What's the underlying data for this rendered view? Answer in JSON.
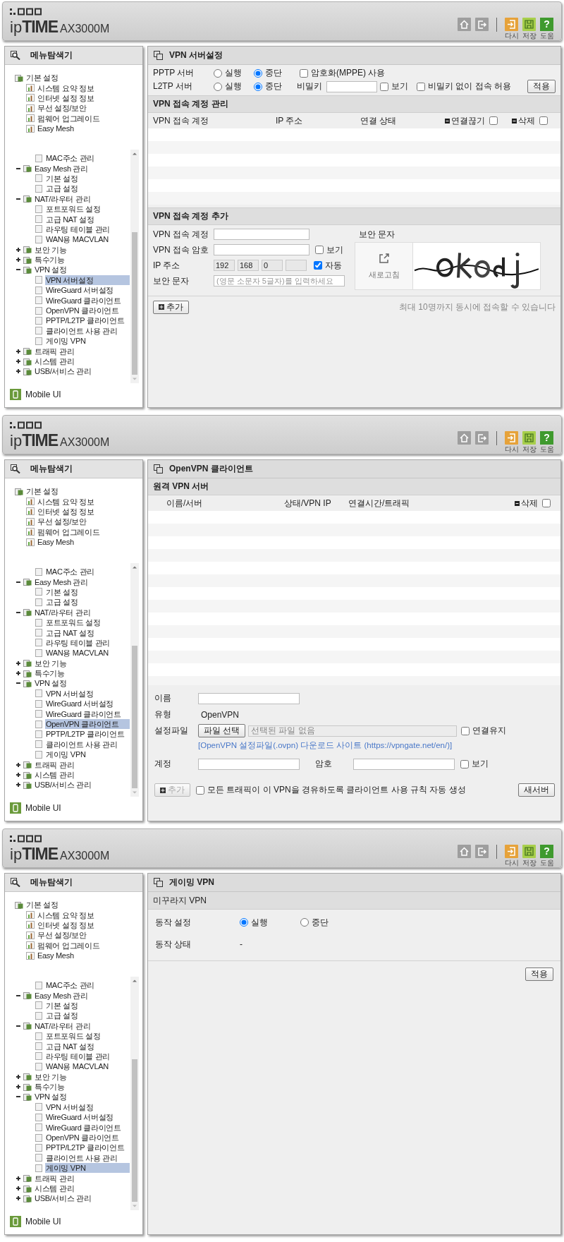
{
  "screens": [
    {
      "header": {
        "logo": {
          "prefix": "ip",
          "name": "TIME",
          "model": "AX3000M"
        },
        "actions": [
          {
            "kind": "home"
          },
          {
            "kind": "logout"
          },
          {
            "kind": "refresh",
            "label": "다시"
          },
          {
            "kind": "save",
            "label": "저장"
          },
          {
            "kind": "help",
            "label": "도움",
            "glyph": "?"
          }
        ]
      },
      "sidebar": {
        "title": "메뉴탐색기",
        "top_tree": [
          {
            "label": "기본 설정",
            "selected": false,
            "children": [
              {
                "label": "시스템 요약 정보",
                "selected": false
              },
              {
                "label": "인터넷 설정 정보",
                "selected": false
              },
              {
                "label": "무선 설정/보안",
                "selected": false
              },
              {
                "label": "펌웨어 업그레이드",
                "selected": false
              },
              {
                "label": "Easy Mesh",
                "selected": false
              }
            ]
          }
        ],
        "scroll_tree": [
          {
            "children": [
              {
                "label": "MAC주소 관리",
                "selected": false
              }
            ]
          },
          {
            "label": "Easy Mesh 관리",
            "expanded": true,
            "selected": false,
            "children": [
              {
                "label": "기본 설정",
                "selected": false
              },
              {
                "label": "고급 설정",
                "selected": false
              }
            ]
          },
          {
            "label": "NAT/라우터 관리",
            "expanded": true,
            "selected": false,
            "children": [
              {
                "label": "포트포워드 설정",
                "selected": false
              },
              {
                "label": "고급 NAT 설정",
                "selected": false
              },
              {
                "label": "라우팅 테이블 관리",
                "selected": false
              },
              {
                "label": "WAN용 MACVLAN",
                "selected": false
              }
            ]
          },
          {
            "label": "보안 기능",
            "expanded": false,
            "selected": false
          },
          {
            "label": "특수기능",
            "expanded": false,
            "selected": false
          },
          {
            "label": "VPN 설정",
            "expanded": true,
            "selected": false,
            "children": [
              {
                "label": "VPN 서버설정",
                "selected": true
              },
              {
                "label": "WireGuard 서버설정",
                "selected": false
              },
              {
                "label": "WireGuard 클라이언트",
                "selected": false
              },
              {
                "label": "OpenVPN 클라이언트",
                "selected": false
              },
              {
                "label": "PPTP/L2TP 클라이언트",
                "selected": false
              },
              {
                "label": "클라이언트 사용 관리",
                "selected": false
              },
              {
                "label": "게이밍 VPN",
                "selected": false
              }
            ]
          },
          {
            "label": "트래픽 관리",
            "expanded": false,
            "selected": false
          },
          {
            "label": "시스템 관리",
            "expanded": false,
            "selected": false
          },
          {
            "label": "USB/서비스 관리",
            "expanded": false,
            "selected": false
          }
        ],
        "mobile_link": "Mobile UI"
      },
      "main": {
        "kind": "vpn_server",
        "title": "VPN 서버설정",
        "servers": [
          {
            "label": "PPTP 서버",
            "options": [
              {
                "label": "실행",
                "selected": false
              },
              {
                "label": "중단",
                "selected": true
              }
            ],
            "encryption": {
              "label": "암호화(MPPE) 사용",
              "checked": false
            }
          },
          {
            "label": "L2TP 서버",
            "options": [
              {
                "label": "실행",
                "selected": false
              },
              {
                "label": "중단",
                "selected": true
              }
            ],
            "secret_label": "비밀키",
            "show": {
              "label": "보기",
              "checked": false
            },
            "no_secret": {
              "label": "비밀키 없이 접속 허용",
              "checked": false
            }
          }
        ],
        "apply_button": "적용",
        "accounts": {
          "title": "VPN 접속 계정 관리",
          "columns": [
            {
              "label": "VPN 접속 계정"
            },
            {
              "label": "IP 주소"
            },
            {
              "label": "연결 상태"
            },
            {
              "label": "연결끊기",
              "checked": false
            },
            {
              "label": "삭제",
              "checked": false
            }
          ]
        },
        "add": {
          "title": "VPN 접속 계정 추가",
          "account_label": "VPN 접속 계정",
          "password_label": "VPN 접속 암호",
          "show": {
            "label": "보기",
            "checked": false
          },
          "ip_label": "IP 주소",
          "ip": [
            "192",
            "168",
            "0"
          ],
          "auto": {
            "label": "자동",
            "checked": true
          },
          "captcha_label": "보안 문자",
          "captcha_placeholder": "(영문 소문자 5글자)를 입력하세요",
          "captcha_title": "보안 문자",
          "refresh": "새로고침",
          "add_button": "추가",
          "note": "최대 10명까지 동시에 접속할 수 있습니다"
        }
      }
    },
    {
      "header": {
        "logo": {
          "prefix": "ip",
          "name": "TIME",
          "model": "AX3000M"
        },
        "actions": [
          {
            "kind": "home"
          },
          {
            "kind": "logout"
          },
          {
            "kind": "refresh",
            "label": "다시"
          },
          {
            "kind": "save",
            "label": "저장"
          },
          {
            "kind": "help",
            "label": "도움",
            "glyph": "?"
          }
        ]
      },
      "sidebar": {
        "title": "메뉴탐색기",
        "top_tree": [
          {
            "label": "기본 설정",
            "selected": false,
            "children": [
              {
                "label": "시스템 요약 정보",
                "selected": false
              },
              {
                "label": "인터넷 설정 정보",
                "selected": false
              },
              {
                "label": "무선 설정/보안",
                "selected": false
              },
              {
                "label": "펌웨어 업그레이드",
                "selected": false
              },
              {
                "label": "Easy Mesh",
                "selected": false
              }
            ]
          }
        ],
        "scroll_tree": [
          {
            "children": [
              {
                "label": "MAC주소 관리",
                "selected": false
              }
            ]
          },
          {
            "label": "Easy Mesh 관리",
            "expanded": true,
            "selected": false,
            "children": [
              {
                "label": "기본 설정",
                "selected": false
              },
              {
                "label": "고급 설정",
                "selected": false
              }
            ]
          },
          {
            "label": "NAT/라우터 관리",
            "expanded": true,
            "selected": false,
            "children": [
              {
                "label": "포트포워드 설정",
                "selected": false
              },
              {
                "label": "고급 NAT 설정",
                "selected": false
              },
              {
                "label": "라우팅 테이블 관리",
                "selected": false
              },
              {
                "label": "WAN용 MACVLAN",
                "selected": false
              }
            ]
          },
          {
            "label": "보안 기능",
            "expanded": false,
            "selected": false
          },
          {
            "label": "특수기능",
            "expanded": false,
            "selected": false
          },
          {
            "label": "VPN 설정",
            "expanded": true,
            "selected": false,
            "children": [
              {
                "label": "VPN 서버설정",
                "selected": false
              },
              {
                "label": "WireGuard 서버설정",
                "selected": false
              },
              {
                "label": "WireGuard 클라이언트",
                "selected": false
              },
              {
                "label": "OpenVPN 클라이언트",
                "selected": true
              },
              {
                "label": "PPTP/L2TP 클라이언트",
                "selected": false
              },
              {
                "label": "클라이언트 사용 관리",
                "selected": false
              },
              {
                "label": "게이밍 VPN",
                "selected": false
              }
            ]
          },
          {
            "label": "트래픽 관리",
            "expanded": false,
            "selected": false
          },
          {
            "label": "시스템 관리",
            "expanded": false,
            "selected": false
          },
          {
            "label": "USB/서비스 관리",
            "expanded": false,
            "selected": false
          }
        ],
        "mobile_link": "Mobile UI"
      },
      "main": {
        "kind": "openvpn",
        "title": "OpenVPN 클라이언트",
        "subtitle": "원격 VPN 서버",
        "columns": [
          {
            "label": "이름/서버"
          },
          {
            "label": "상태/VPN IP"
          },
          {
            "label": "연결시간/트래픽"
          },
          {
            "label": "삭제",
            "checked": false
          }
        ],
        "name_label": "이름",
        "type_label": "유형",
        "type_value": "OpenVPN",
        "file_label": "설정파일",
        "file_button": "파일 선택",
        "file_status": "선택된 파일 없음",
        "keep_alive": {
          "label": "연결유지",
          "checked": false
        },
        "download_link": "[OpenVPN 설정파일(.ovpn) 다운로드 사이트 (https://vpngate.net/en/)]",
        "account_label": "계정",
        "password_label": "암호",
        "show": {
          "label": "보기",
          "checked": false
        },
        "add_button": {
          "label": "추가",
          "disabled": true
        },
        "auto_rule": {
          "label": "모든 트래픽이 이 VPN을 경유하도록 클라이언트 사용 규칙 자동 생성",
          "checked": false
        },
        "new_server_button": "새서버"
      }
    },
    {
      "header": {
        "logo": {
          "prefix": "ip",
          "name": "TIME",
          "model": "AX3000M"
        },
        "actions": [
          {
            "kind": "home"
          },
          {
            "kind": "logout"
          },
          {
            "kind": "refresh",
            "label": "다시"
          },
          {
            "kind": "save",
            "label": "저장"
          },
          {
            "kind": "help",
            "label": "도움",
            "glyph": "?"
          }
        ]
      },
      "sidebar": {
        "title": "메뉴탐색기",
        "top_tree": [
          {
            "label": "기본 설정",
            "selected": false,
            "children": [
              {
                "label": "시스템 요약 정보",
                "selected": false
              },
              {
                "label": "인터넷 설정 정보",
                "selected": false
              },
              {
                "label": "무선 설정/보안",
                "selected": false
              },
              {
                "label": "펌웨어 업그레이드",
                "selected": false
              },
              {
                "label": "Easy Mesh",
                "selected": false
              }
            ]
          }
        ],
        "scroll_tree": [
          {
            "children": [
              {
                "label": "MAC주소 관리",
                "selected": false
              }
            ]
          },
          {
            "label": "Easy Mesh 관리",
            "expanded": true,
            "selected": false,
            "children": [
              {
                "label": "기본 설정",
                "selected": false
              },
              {
                "label": "고급 설정",
                "selected": false
              }
            ]
          },
          {
            "label": "NAT/라우터 관리",
            "expanded": true,
            "selected": false,
            "children": [
              {
                "label": "포트포워드 설정",
                "selected": false
              },
              {
                "label": "고급 NAT 설정",
                "selected": false
              },
              {
                "label": "라우팅 테이블 관리",
                "selected": false
              },
              {
                "label": "WAN용 MACVLAN",
                "selected": false
              }
            ]
          },
          {
            "label": "보안 기능",
            "expanded": false,
            "selected": false
          },
          {
            "label": "특수기능",
            "expanded": false,
            "selected": false
          },
          {
            "label": "VPN 설정",
            "expanded": true,
            "selected": false,
            "children": [
              {
                "label": "VPN 서버설정",
                "selected": false
              },
              {
                "label": "WireGuard 서버설정",
                "selected": false
              },
              {
                "label": "WireGuard 클라이언트",
                "selected": false
              },
              {
                "label": "OpenVPN 클라이언트",
                "selected": false
              },
              {
                "label": "PPTP/L2TP 클라이언트",
                "selected": false
              },
              {
                "label": "클라이언트 사용 관리",
                "selected": false
              },
              {
                "label": "게이밍 VPN",
                "selected": true
              }
            ]
          },
          {
            "label": "트래픽 관리",
            "expanded": false,
            "selected": false
          },
          {
            "label": "시스템 관리",
            "expanded": false,
            "selected": false
          },
          {
            "label": "USB/서비스 관리",
            "expanded": false,
            "selected": false
          }
        ],
        "mobile_link": "Mobile UI"
      },
      "main": {
        "kind": "gaming",
        "title": "게이밍 VPN",
        "subtitle": "미꾸라지 VPN",
        "mode_label": "동작 설정",
        "options": [
          {
            "label": "실행",
            "selected": true
          },
          {
            "label": "중단",
            "selected": false
          }
        ],
        "status_label": "동작 상태",
        "status_value": "-",
        "apply_button": "적용"
      }
    }
  ]
}
